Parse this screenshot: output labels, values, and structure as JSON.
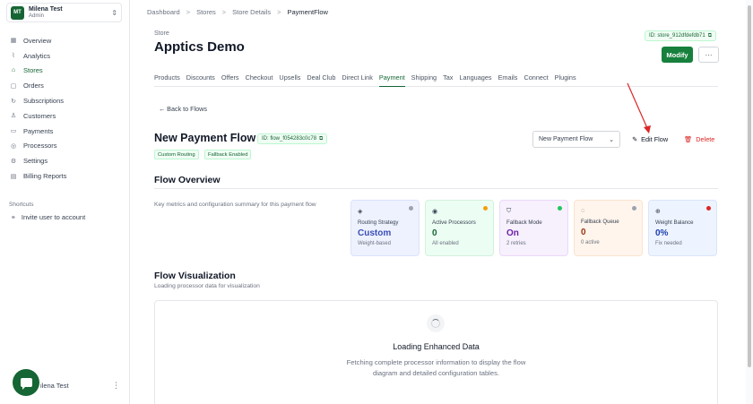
{
  "org": {
    "initials": "MT",
    "name": "Milena Test",
    "role": "Admin"
  },
  "nav": [
    {
      "label": "Overview",
      "icon": "grid-icon",
      "glyph": "▦",
      "active": false
    },
    {
      "label": "Analytics",
      "icon": "chart-icon",
      "glyph": "⌇",
      "active": false
    },
    {
      "label": "Stores",
      "icon": "store-icon",
      "glyph": "⌂",
      "active": true
    },
    {
      "label": "Orders",
      "icon": "box-icon",
      "glyph": "▢",
      "active": false
    },
    {
      "label": "Subscriptions",
      "icon": "repeat-icon",
      "glyph": "↻",
      "active": false
    },
    {
      "label": "Customers",
      "icon": "user-icon",
      "glyph": "♙",
      "active": false
    },
    {
      "label": "Payments",
      "icon": "card-icon",
      "glyph": "▭",
      "active": false
    },
    {
      "label": "Processors",
      "icon": "cpu-icon",
      "glyph": "◎",
      "active": false
    },
    {
      "label": "Settings",
      "icon": "gear-icon",
      "glyph": "⚙",
      "active": false
    },
    {
      "label": "Billing Reports",
      "icon": "document-icon",
      "glyph": "▤",
      "active": false
    }
  ],
  "shortcuts": {
    "title": "Shortcuts",
    "invite": "Invite user to account"
  },
  "footer_user": "ilena Test",
  "breadcrumb": {
    "items": [
      "Dashboard",
      "Stores",
      "Store Details"
    ],
    "current": "PaymentFlow",
    "separator": ">"
  },
  "store": {
    "label": "Store",
    "name": "Apptics Demo",
    "id": "ID: store_912dfdefdb71"
  },
  "actions": {
    "modify": "Modify",
    "more": "···"
  },
  "tabs": [
    {
      "label": "Products",
      "active": false
    },
    {
      "label": "Discounts",
      "active": false
    },
    {
      "label": "Offers",
      "active": false
    },
    {
      "label": "Checkout",
      "active": false
    },
    {
      "label": "Upsells",
      "active": false
    },
    {
      "label": "Deal Club",
      "active": false
    },
    {
      "label": "Direct Link",
      "active": false
    },
    {
      "label": "Payment",
      "active": true
    },
    {
      "label": "Shipping",
      "active": false
    },
    {
      "label": "Tax",
      "active": false
    },
    {
      "label": "Languages",
      "active": false
    },
    {
      "label": "Emails",
      "active": false
    },
    {
      "label": "Connect",
      "active": false
    },
    {
      "label": "Plugins",
      "active": false
    }
  ],
  "back_link": "← Back to Flows",
  "flow": {
    "title": "New Payment Flow",
    "id": "ID: flow_f054283c0c78",
    "tags": [
      "Custom Routing",
      "Fallback Enabled"
    ],
    "select_value": "New Payment Flow",
    "edit_label": "Edit Flow",
    "delete_label": "Delete"
  },
  "overview": {
    "title": "Flow Overview",
    "description": "Key metrics and configuration summary for this payment flow",
    "cards": [
      {
        "label": "Routing Strategy",
        "value": "Custom",
        "sub": "Weight-based",
        "icon": "routing-icon",
        "glyph": "◈",
        "bg": "#eef2ff",
        "border": "#dbe2fb",
        "value_color": "#3b4fb8",
        "dot": "#9ca3af"
      },
      {
        "label": "Active Processors",
        "value": "0",
        "sub": "All enabled",
        "icon": "processor-icon",
        "glyph": "◉",
        "bg": "#ecfdf3",
        "border": "#d1f2dc",
        "value_color": "#166534",
        "dot": "#f59e0b"
      },
      {
        "label": "Fallback Mode",
        "value": "On",
        "sub": "2 retries",
        "icon": "shield-icon",
        "glyph": "⛉",
        "bg": "#f7f0fd",
        "border": "#ead9fa",
        "value_color": "#6b21a8",
        "dot": "#22c55e"
      },
      {
        "label": "Fallback Queue",
        "value": "0",
        "sub": "0 active",
        "icon": "queue-icon",
        "glyph": "◌",
        "bg": "#fff5ec",
        "border": "#fbe3cf",
        "value_color": "#9a3412",
        "dot": "#9ca3af"
      },
      {
        "label": "Weight Balance",
        "value": "0%",
        "sub": "Fix needed",
        "icon": "balance-icon",
        "glyph": "⊕",
        "bg": "#eef4ff",
        "border": "#d9e5fb",
        "value_color": "#1e40af",
        "dot": "#dc2626"
      }
    ]
  },
  "visualization": {
    "title": "Flow Visualization",
    "description": "Loading processor data for visualization",
    "loading_title": "Loading Enhanced Data",
    "loading_desc": "Fetching complete processor information to display the flow diagram and detailed configuration tables."
  }
}
